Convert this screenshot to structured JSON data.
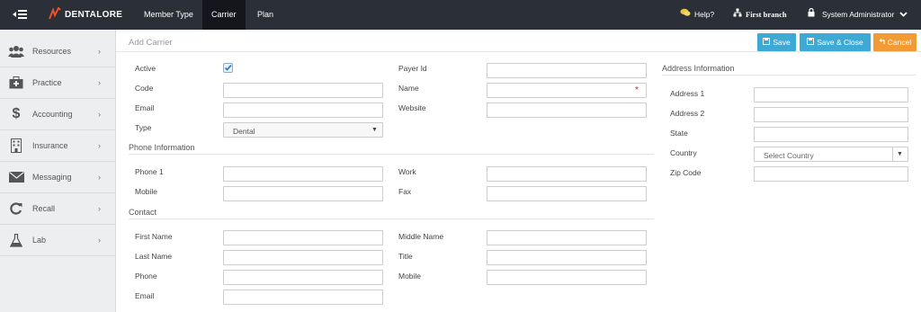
{
  "topbar": {
    "logo_text": "DENTALORE",
    "tabs": [
      {
        "label": "Member Type",
        "active": false
      },
      {
        "label": "Carrier",
        "active": true
      },
      {
        "label": "Plan",
        "active": false
      }
    ],
    "help_label": "Help?",
    "branch_label": "First branch",
    "user_label": "System Administrator"
  },
  "sidebar": {
    "items": [
      {
        "label": "Resources",
        "icon": "users-icon"
      },
      {
        "label": "Practice",
        "icon": "medical-kit-icon"
      },
      {
        "label": "Accounting",
        "icon": "dollar-icon"
      },
      {
        "label": "Insurance",
        "icon": "building-icon"
      },
      {
        "label": "Messaging",
        "icon": "envelope-icon"
      },
      {
        "label": "Recall",
        "icon": "refresh-icon"
      },
      {
        "label": "Lab",
        "icon": "flask-icon"
      }
    ]
  },
  "page": {
    "title": "Add Carrier",
    "save_label": "Save",
    "save_close_label": "Save & Close",
    "cancel_label": "Cancel"
  },
  "carrier": {
    "active_label": "Active",
    "active_checked": true,
    "code_label": "Code",
    "email_label": "Email",
    "type_label": "Type",
    "type_value": "Dental",
    "payer_id_label": "Payer Id",
    "name_label": "Name",
    "website_label": "Website"
  },
  "phone_info": {
    "title": "Phone Information",
    "phone1_label": "Phone 1",
    "mobile_label": "Mobile",
    "work_label": "Work",
    "fax_label": "Fax"
  },
  "contact": {
    "title": "Contact",
    "first_name_label": "First Name",
    "last_name_label": "Last Name",
    "phone_label": "Phone",
    "email_label": "Email",
    "middle_name_label": "Middle Name",
    "title_label": "Title",
    "mobile_label": "Mobile"
  },
  "address": {
    "title": "Address Information",
    "address1_label": "Address 1",
    "address2_label": "Address 2",
    "state_label": "State",
    "country_label": "Country",
    "country_placeholder": "Select Country",
    "zip_label": "Zip Code"
  },
  "colors": {
    "topbar": "#2b2f38",
    "accent_blue": "#3fa9d5",
    "cancel_orange": "#f29b34",
    "logo_orange": "#e8542a"
  }
}
